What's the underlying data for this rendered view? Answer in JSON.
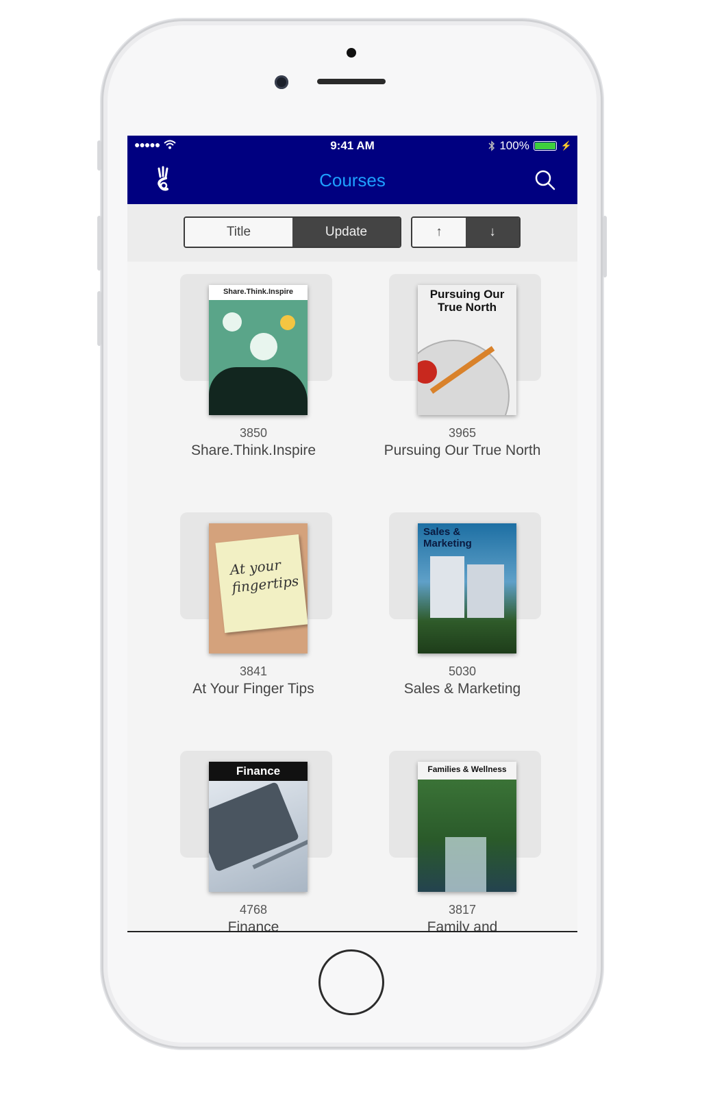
{
  "status_bar": {
    "time": "9:41 AM",
    "battery": "100%",
    "battery_level": 1.0
  },
  "header": {
    "title": "Courses"
  },
  "sort": {
    "title_label": "Title",
    "update_label": "Update",
    "asc_label": "↑",
    "desc_label": "↓",
    "active": "Update"
  },
  "courses": [
    {
      "id": "3850",
      "name": "Share.Think.Inspire",
      "cover_text": "Share.Think.Inspire"
    },
    {
      "id": "3965",
      "name": "Pursuing Our True North",
      "cover_text": "Pursuing Our True North"
    },
    {
      "id": "3841",
      "name": "At Your Finger Tips",
      "cover_text": "At your fingertips"
    },
    {
      "id": "5030",
      "name": "Sales & Marketing",
      "cover_text": "Sales & Marketing"
    },
    {
      "id": "4768",
      "name": "Finance",
      "cover_text": "Finance"
    },
    {
      "id": "3817",
      "name": "Family and",
      "cover_text": "Families & Wellness"
    }
  ],
  "colors": {
    "nav_bg": "#000080",
    "title_blue": "#1ea0ff",
    "active_segment": "#444444"
  }
}
